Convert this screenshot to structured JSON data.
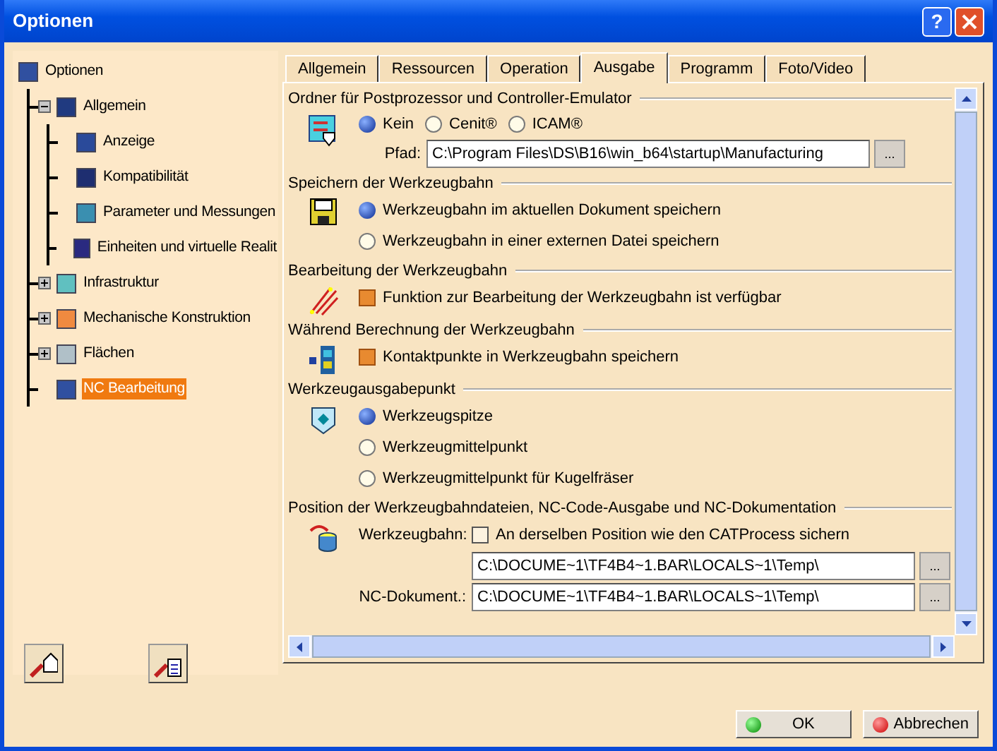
{
  "window": {
    "title": "Optionen",
    "help": "?"
  },
  "tree": {
    "label": "Optionen",
    "selected": false,
    "children": [
      {
        "label": "Allgemein",
        "selected": false,
        "expanded": true,
        "children": [
          {
            "label": "Anzeige",
            "selected": false
          },
          {
            "label": "Kompatibilität",
            "selected": false
          },
          {
            "label": "Parameter und Messungen",
            "selected": false
          },
          {
            "label": "Einheiten und virtuelle Realit",
            "selected": false
          }
        ]
      },
      {
        "label": "Infrastruktur",
        "selected": false,
        "expanded": false
      },
      {
        "label": "Mechanische Konstruktion",
        "selected": false,
        "expanded": false
      },
      {
        "label": "Flächen",
        "selected": false,
        "expanded": false
      },
      {
        "label": "NC Bearbeitung",
        "selected": true
      }
    ]
  },
  "tabs": [
    {
      "label": "Allgemein",
      "selected": false
    },
    {
      "label": "Ressourcen",
      "selected": false
    },
    {
      "label": "Operation",
      "selected": false
    },
    {
      "label": "Ausgabe",
      "selected": true
    },
    {
      "label": "Programm",
      "selected": false
    },
    {
      "label": "Foto/Video",
      "selected": false
    }
  ],
  "sections": [
    {
      "title": "Ordner für Postprozessor und Controller-Emulator",
      "items": [
        {
          "kind": "radios_inline",
          "options": [
            {
              "label": "Kein",
              "selected": true
            },
            {
              "label": "Cenit®",
              "selected": false
            },
            {
              "label": "ICAM®",
              "selected": false
            }
          ]
        },
        {
          "kind": "path",
          "label": "Pfad:",
          "value": "C:\\Program Files\\DS\\B16\\win_b64\\startup\\Manufacturing",
          "button": "..."
        }
      ]
    },
    {
      "title": "Speichern der Werkzeugbahn",
      "items": [
        {
          "kind": "radio",
          "label": "Werkzeugbahn im aktuellen Dokument speichern",
          "selected": true
        },
        {
          "kind": "radio",
          "label": "Werkzeugbahn in einer externen Datei speichern",
          "selected": false
        }
      ]
    },
    {
      "title": "Bearbeitung der Werkzeugbahn",
      "items": [
        {
          "kind": "checkbox",
          "label": "Funktion zur Bearbeitung der Werkzeugbahn ist verfügbar",
          "checked": true
        }
      ]
    },
    {
      "title": "Während Berechnung der Werkzeugbahn",
      "items": [
        {
          "kind": "checkbox",
          "label": "Kontaktpunkte in Werkzeugbahn speichern",
          "checked": true
        }
      ]
    },
    {
      "title": "Werkzeugausgabepunkt",
      "items": [
        {
          "kind": "radio",
          "label": "Werkzeugspitze",
          "selected": true
        },
        {
          "kind": "radio",
          "label": "Werkzeugmittelpunkt",
          "selected": false
        },
        {
          "kind": "radio",
          "label": "Werkzeugmittelpunkt für Kugelfräser",
          "selected": false
        }
      ]
    },
    {
      "title": "Position der Werkzeugbahndateien, NC-Code-Ausgabe und NC-Dokumentation",
      "items": [
        {
          "kind": "labeled_checkbox",
          "label": "Werkzeugbahn:",
          "text": "An derselben Position wie den CATProcess sichern",
          "checked": false
        },
        {
          "kind": "path",
          "value": "C:\\DOCUME~1\\TF4B4~1.BAR\\LOCALS~1\\Temp\\",
          "button": "..."
        },
        {
          "kind": "path",
          "label": "NC-Dokument.:",
          "value": "C:\\DOCUME~1\\TF4B4~1.BAR\\LOCALS~1\\Temp\\",
          "button": "..."
        }
      ]
    }
  ],
  "footer": {
    "ok": "OK",
    "cancel": "Abbrechen"
  }
}
